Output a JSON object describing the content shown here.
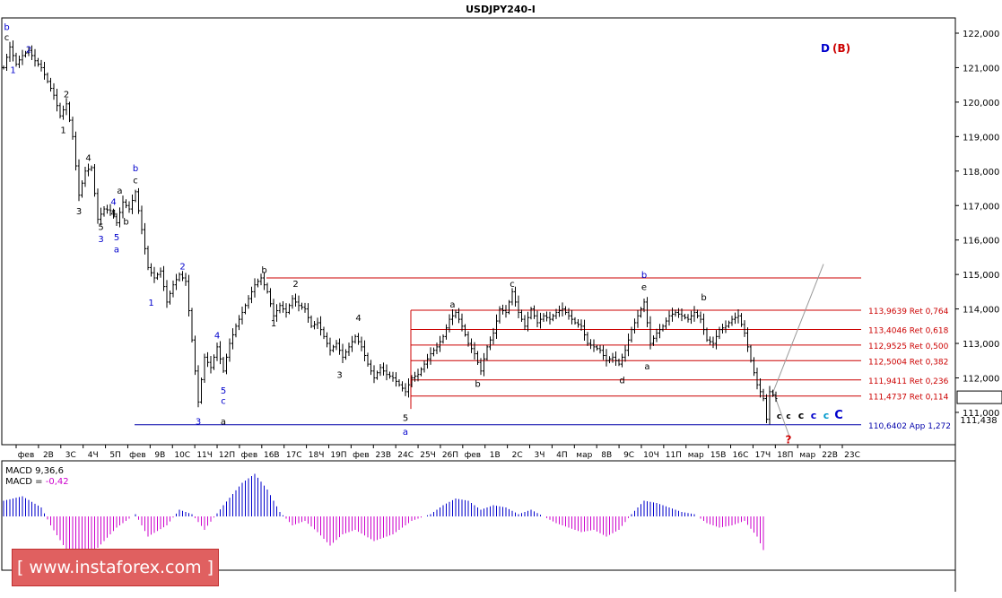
{
  "chart_data": {
    "type": "candlestick",
    "title": "USDJPY240-I",
    "wave_title": {
      "primary": "D",
      "secondary": "(B)"
    },
    "y_ticks": [
      "122,000",
      "121,000",
      "120,000",
      "119,000",
      "118,000",
      "117,000",
      "116,000",
      "115,000",
      "114,000",
      "113,000",
      "112,000",
      "111,000"
    ],
    "ylim": [
      110.2,
      122.3
    ],
    "current_price": "111,438",
    "x_ticks": [
      "фев",
      "2В",
      "3С",
      "4Ч",
      "5П",
      "фев",
      "9В",
      "10С",
      "11Ч",
      "12П",
      "фев",
      "16В",
      "17С",
      "18Ч",
      "19П",
      "фев",
      "23В",
      "24С",
      "25Ч",
      "26П",
      "фев",
      "1В",
      "2С",
      "3Ч",
      "4П",
      "мар",
      "8В",
      "9С",
      "10Ч",
      "11П",
      "мар",
      "15В",
      "16С",
      "17Ч",
      "18П",
      "мар",
      "22В",
      "23С"
    ],
    "fib_levels": [
      {
        "price": 113.9639,
        "label": "113,9639 Ret 0,764"
      },
      {
        "price": 113.4046,
        "label": "113,4046 Ret 0,618"
      },
      {
        "price": 112.9525,
        "label": "112,9525 Ret 0,500"
      },
      {
        "price": 112.5004,
        "label": "112,5004 Ret 0,382"
      },
      {
        "price": 111.9411,
        "label": "111,9411 Ret 0,236"
      },
      {
        "price": 111.4737,
        "label": "111,4737 Ret 0,114"
      },
      {
        "price": 110.6402,
        "label": "110,6402 App 1,272"
      }
    ],
    "wave_labels": [
      {
        "text": "b",
        "color": "#0000cc",
        "bar": 1,
        "price": 122.2
      },
      {
        "text": "c",
        "color": "#000000",
        "bar": 1,
        "price": 121.9
      },
      {
        "text": "2",
        "color": "#0000cc",
        "bar": 8,
        "price": 121.55
      },
      {
        "text": "1",
        "color": "#0000cc",
        "bar": 3,
        "price": 120.95
      },
      {
        "text": "2",
        "color": "#000000",
        "bar": 20,
        "price": 120.25
      },
      {
        "text": "1",
        "color": "#000000",
        "bar": 19,
        "price": 119.2
      },
      {
        "text": "4",
        "color": "#000000",
        "bar": 27,
        "price": 118.4
      },
      {
        "text": "3",
        "color": "#000000",
        "bar": 24,
        "price": 116.85
      },
      {
        "text": "b",
        "color": "#0000cc",
        "bar": 42,
        "price": 118.1
      },
      {
        "text": "c",
        "color": "#000000",
        "bar": 42,
        "price": 117.75
      },
      {
        "text": "a",
        "color": "#000000",
        "bar": 37,
        "price": 117.45
      },
      {
        "text": "4",
        "color": "#0000cc",
        "bar": 35,
        "price": 117.12
      },
      {
        "text": "b",
        "color": "#000000",
        "bar": 39,
        "price": 116.55
      },
      {
        "text": "5",
        "color": "#000000",
        "bar": 31,
        "price": 116.4
      },
      {
        "text": "4",
        "color": "#000000",
        "bar": 35,
        "price": 116.8
      },
      {
        "text": "3",
        "color": "#0000cc",
        "bar": 31,
        "price": 116.05
      },
      {
        "text": "5",
        "color": "#0000cc",
        "bar": 36,
        "price": 116.1
      },
      {
        "text": "a",
        "color": "#0000cc",
        "bar": 36,
        "price": 115.75
      },
      {
        "text": "2",
        "color": "#0000cc",
        "bar": 57,
        "price": 115.25
      },
      {
        "text": "1",
        "color": "#0000cc",
        "bar": 47,
        "price": 114.2
      },
      {
        "text": "4",
        "color": "#0000cc",
        "bar": 68,
        "price": 113.25
      },
      {
        "text": "5",
        "color": "#0000cc",
        "bar": 70,
        "price": 111.65
      },
      {
        "text": "c",
        "color": "#0000cc",
        "bar": 70,
        "price": 111.35
      },
      {
        "text": "3",
        "color": "#0000cc",
        "bar": 62,
        "price": 110.75
      },
      {
        "text": "a",
        "color": "#000000",
        "bar": 70,
        "price": 110.75
      },
      {
        "text": "b",
        "color": "#000000",
        "bar": 83,
        "price": 115.15
      },
      {
        "text": "2",
        "color": "#000000",
        "bar": 93,
        "price": 114.75
      },
      {
        "text": "1",
        "color": "#000000",
        "bar": 86,
        "price": 113.6
      },
      {
        "text": "4",
        "color": "#000000",
        "bar": 113,
        "price": 113.75
      },
      {
        "text": "3",
        "color": "#000000",
        "bar": 107,
        "price": 112.1
      },
      {
        "text": "5",
        "color": "#000000",
        "bar": 128,
        "price": 110.85
      },
      {
        "text": "a",
        "color": "#0000cc",
        "bar": 128,
        "price": 110.45
      },
      {
        "text": "a",
        "color": "#000000",
        "bar": 143,
        "price": 114.15
      },
      {
        "text": "b",
        "color": "#000000",
        "bar": 151,
        "price": 111.85
      },
      {
        "text": "c",
        "color": "#000000",
        "bar": 162,
        "price": 114.75
      },
      {
        "text": "d",
        "color": "#000000",
        "bar": 197,
        "price": 111.95
      },
      {
        "text": "b",
        "color": "#0000cc",
        "bar": 204,
        "price": 115.0
      },
      {
        "text": "e",
        "color": "#000000",
        "bar": 204,
        "price": 114.65
      },
      {
        "text": "a",
        "color": "#000000",
        "bar": 205,
        "price": 112.35
      },
      {
        "text": "b",
        "color": "#000000",
        "bar": 223,
        "price": 114.35
      },
      {
        "text": "?",
        "color": "#cc0000",
        "bar": 250,
        "price": 110.2
      }
    ],
    "c_labels": [
      {
        "text": "c",
        "color": "#000000",
        "bar": 247,
        "size": 9
      },
      {
        "text": "c",
        "color": "#000000",
        "bar": 250,
        "size": 9
      },
      {
        "text": "c",
        "color": "#000000",
        "bar": 254,
        "size": 11
      },
      {
        "text": "c",
        "color": "#0000cc",
        "bar": 258,
        "size": 11
      },
      {
        "text": "c",
        "color": "#0099cc",
        "bar": 262,
        "size": 11
      },
      {
        "text": "C",
        "color": "#0000cc",
        "bar": 266,
        "size": 13
      }
    ],
    "price_path": [
      [
        0,
        121.0
      ],
      [
        2,
        121.6
      ],
      [
        4,
        121.1
      ],
      [
        6,
        121.35
      ],
      [
        8,
        121.5
      ],
      [
        10,
        121.2
      ],
      [
        12,
        121.0
      ],
      [
        14,
        120.6
      ],
      [
        16,
        120.2
      ],
      [
        18,
        119.6
      ],
      [
        20,
        119.95
      ],
      [
        22,
        119.0
      ],
      [
        24,
        117.3
      ],
      [
        26,
        118.0
      ],
      [
        28,
        118.1
      ],
      [
        30,
        116.6
      ],
      [
        32,
        116.9
      ],
      [
        34,
        116.85
      ],
      [
        36,
        116.5
      ],
      [
        38,
        117.1
      ],
      [
        40,
        116.9
      ],
      [
        42,
        117.4
      ],
      [
        44,
        116.3
      ],
      [
        46,
        115.2
      ],
      [
        48,
        114.9
      ],
      [
        50,
        115.1
      ],
      [
        52,
        114.2
      ],
      [
        54,
        114.7
      ],
      [
        56,
        115.0
      ],
      [
        58,
        114.8
      ],
      [
        60,
        113.1
      ],
      [
        62,
        111.3
      ],
      [
        64,
        112.6
      ],
      [
        66,
        112.3
      ],
      [
        68,
        112.9
      ],
      [
        70,
        112.2
      ],
      [
        72,
        113.0
      ],
      [
        74,
        113.5
      ],
      [
        76,
        113.9
      ],
      [
        78,
        114.3
      ],
      [
        80,
        114.7
      ],
      [
        82,
        114.9
      ],
      [
        84,
        114.5
      ],
      [
        86,
        113.8
      ],
      [
        88,
        114.1
      ],
      [
        90,
        113.9
      ],
      [
        92,
        114.3
      ],
      [
        94,
        114.1
      ],
      [
        96,
        114.0
      ],
      [
        98,
        113.5
      ],
      [
        100,
        113.6
      ],
      [
        102,
        113.2
      ],
      [
        104,
        112.8
      ],
      [
        106,
        113.0
      ],
      [
        108,
        112.6
      ],
      [
        110,
        112.9
      ],
      [
        112,
        113.2
      ],
      [
        114,
        112.9
      ],
      [
        116,
        112.4
      ],
      [
        118,
        112.0
      ],
      [
        120,
        112.3
      ],
      [
        122,
        112.1
      ],
      [
        124,
        112.0
      ],
      [
        126,
        111.8
      ],
      [
        128,
        111.6
      ],
      [
        130,
        112.0
      ],
      [
        132,
        112.1
      ],
      [
        134,
        112.4
      ],
      [
        136,
        112.7
      ],
      [
        138,
        112.9
      ],
      [
        140,
        113.2
      ],
      [
        142,
        113.7
      ],
      [
        144,
        113.9
      ],
      [
        146,
        113.5
      ],
      [
        148,
        113.0
      ],
      [
        150,
        112.7
      ],
      [
        152,
        112.2
      ],
      [
        154,
        112.9
      ],
      [
        156,
        113.3
      ],
      [
        158,
        114.0
      ],
      [
        160,
        113.9
      ],
      [
        162,
        114.5
      ],
      [
        164,
        113.9
      ],
      [
        166,
        113.5
      ],
      [
        168,
        114.0
      ],
      [
        170,
        113.6
      ],
      [
        172,
        113.8
      ],
      [
        174,
        113.7
      ],
      [
        176,
        113.9
      ],
      [
        178,
        114.0
      ],
      [
        180,
        113.8
      ],
      [
        182,
        113.6
      ],
      [
        184,
        113.5
      ],
      [
        186,
        113.0
      ],
      [
        188,
        112.9
      ],
      [
        190,
        112.8
      ],
      [
        192,
        112.5
      ],
      [
        194,
        112.6
      ],
      [
        196,
        112.4
      ],
      [
        198,
        112.8
      ],
      [
        200,
        113.4
      ],
      [
        202,
        113.8
      ],
      [
        204,
        114.2
      ],
      [
        206,
        113.0
      ],
      [
        208,
        113.3
      ],
      [
        210,
        113.5
      ],
      [
        212,
        113.8
      ],
      [
        214,
        113.9
      ],
      [
        216,
        113.8
      ],
      [
        218,
        113.7
      ],
      [
        220,
        113.9
      ],
      [
        222,
        113.7
      ],
      [
        224,
        113.1
      ],
      [
        226,
        113.0
      ],
      [
        228,
        113.4
      ],
      [
        230,
        113.5
      ],
      [
        232,
        113.7
      ],
      [
        234,
        113.8
      ],
      [
        236,
        113.3
      ],
      [
        238,
        112.5
      ],
      [
        240,
        111.8
      ],
      [
        242,
        111.4
      ],
      [
        243,
        110.8
      ],
      [
        244,
        111.6
      ],
      [
        246,
        111.4
      ]
    ],
    "macd": {
      "title_label": "MACD 9,36,6",
      "value_label": "MACD = -0,42",
      "histogram": [
        [
          0,
          0.35
        ],
        [
          6,
          0.45
        ],
        [
          12,
          0.2
        ],
        [
          15,
          -0.2
        ],
        [
          20,
          -0.75
        ],
        [
          24,
          -0.9
        ],
        [
          30,
          -0.7
        ],
        [
          36,
          -0.25
        ],
        [
          42,
          0.05
        ],
        [
          46,
          -0.45
        ],
        [
          52,
          -0.2
        ],
        [
          56,
          0.15
        ],
        [
          60,
          0.05
        ],
        [
          64,
          -0.3
        ],
        [
          70,
          0.25
        ],
        [
          76,
          0.75
        ],
        [
          80,
          0.95
        ],
        [
          84,
          0.6
        ],
        [
          88,
          0.1
        ],
        [
          92,
          -0.2
        ],
        [
          96,
          -0.1
        ],
        [
          100,
          -0.35
        ],
        [
          104,
          -0.65
        ],
        [
          108,
          -0.4
        ],
        [
          112,
          -0.3
        ],
        [
          118,
          -0.55
        ],
        [
          124,
          -0.4
        ],
        [
          130,
          -0.1
        ],
        [
          136,
          0.05
        ],
        [
          140,
          0.25
        ],
        [
          144,
          0.4
        ],
        [
          148,
          0.35
        ],
        [
          152,
          0.15
        ],
        [
          156,
          0.25
        ],
        [
          160,
          0.2
        ],
        [
          164,
          0.05
        ],
        [
          168,
          0.15
        ],
        [
          172,
          0.0
        ],
        [
          176,
          -0.15
        ],
        [
          180,
          -0.25
        ],
        [
          184,
          -0.35
        ],
        [
          188,
          -0.3
        ],
        [
          192,
          -0.45
        ],
        [
          196,
          -0.3
        ],
        [
          200,
          0.05
        ],
        [
          204,
          0.35
        ],
        [
          208,
          0.3
        ],
        [
          212,
          0.2
        ],
        [
          216,
          0.1
        ],
        [
          220,
          0.05
        ],
        [
          224,
          -0.15
        ],
        [
          228,
          -0.25
        ],
        [
          232,
          -0.2
        ],
        [
          236,
          -0.1
        ],
        [
          240,
          -0.45
        ],
        [
          242,
          -0.75
        ]
      ],
      "pos_color": "#0000cc",
      "neg_color": "#cc00cc",
      "ylim": [
        -1.0,
        1.0
      ]
    }
  },
  "watermark": "www.instaforex.com"
}
